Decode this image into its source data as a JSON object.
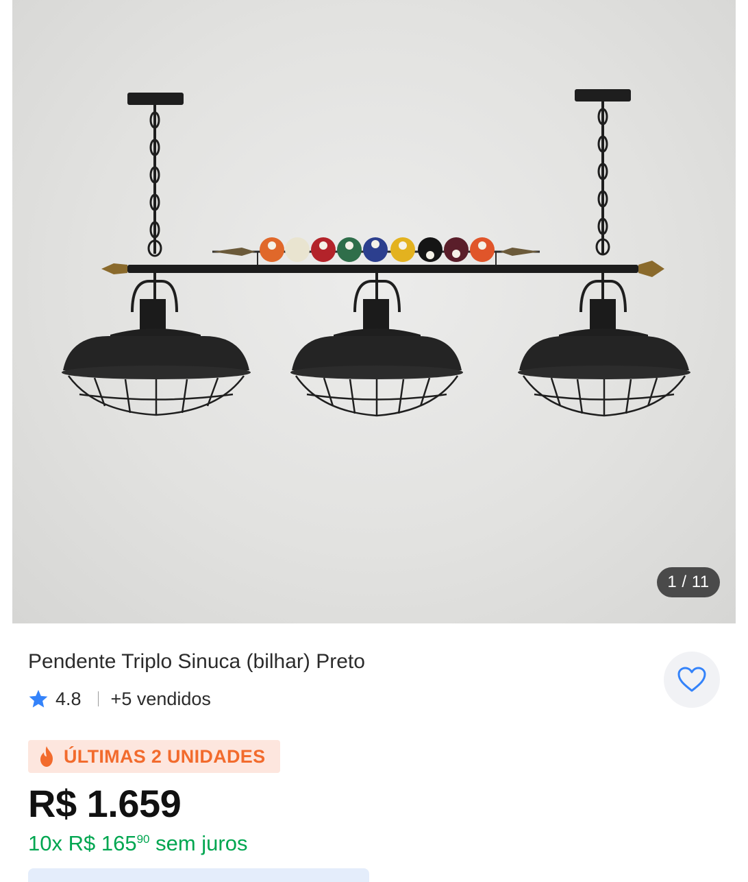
{
  "gallery": {
    "image_alt": "Pendente Triplo Sinuca (bilhar) Preto",
    "counter": "1 / 11"
  },
  "product": {
    "title": "Pendente Triplo Sinuca (bilhar) Preto",
    "rating": "4.8",
    "sold": "+5 vendidos",
    "stock_badge": "ÚLTIMAS 2 UNIDADES",
    "price": "R$ 1.659",
    "installments_prefix": "10x R$ 165",
    "installments_cents": "90",
    "installments_suffix": " sem juros"
  },
  "icons": {
    "favorite": "heart-outline-icon",
    "rating": "star-icon",
    "stock": "flame-icon"
  },
  "colors": {
    "accent_blue": "#3483fa",
    "badge_orange": "#f26b2d",
    "badge_bg": "#fde6de",
    "installments_green": "#00a650"
  }
}
